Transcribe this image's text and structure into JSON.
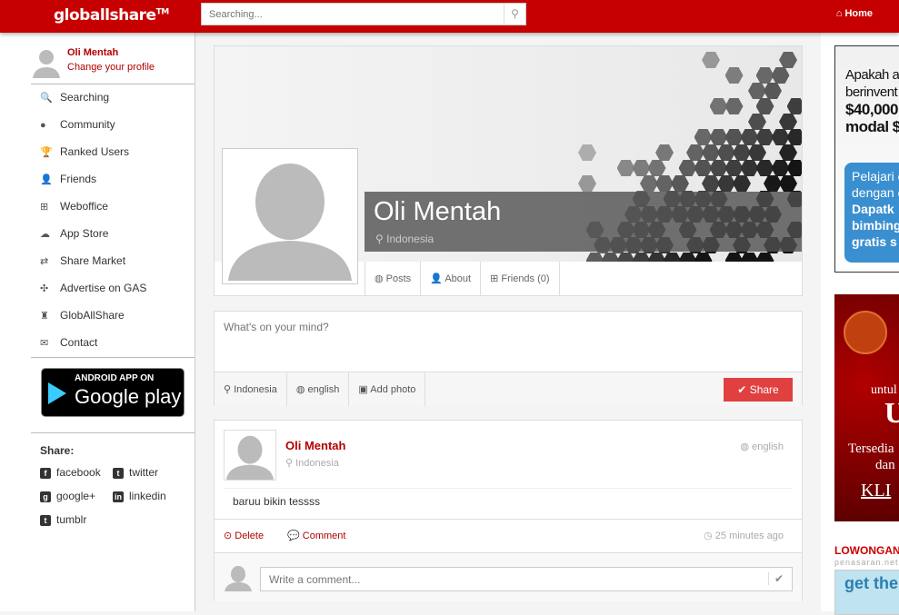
{
  "header": {
    "logo": "globallshare",
    "tm": "TM",
    "search_placeholder": "Searching...",
    "home": "Home"
  },
  "sidebar": {
    "user_name": "Oli Mentah",
    "change_profile": "Change your profile",
    "items": [
      {
        "label": "Searching",
        "icon": "🔍"
      },
      {
        "label": "Community",
        "icon": "●"
      },
      {
        "label": "Ranked Users",
        "icon": "🏆"
      },
      {
        "label": "Friends",
        "icon": "👤"
      },
      {
        "label": "Weboffice",
        "icon": "⊞"
      },
      {
        "label": "App Store",
        "icon": "☁"
      },
      {
        "label": "Share Market",
        "icon": "⇄"
      },
      {
        "label": "Advertise on GAS",
        "icon": "✣"
      },
      {
        "label": "GlobAllShare",
        "icon": "♜"
      },
      {
        "label": "Contact",
        "icon": "✉"
      }
    ],
    "google_play": {
      "line1": "ANDROID APP ON",
      "line2": "Google play"
    },
    "share_title": "Share:",
    "share": [
      {
        "label": "facebook",
        "icon": "f"
      },
      {
        "label": "twitter",
        "icon": "t"
      },
      {
        "label": "google+",
        "icon": "g"
      },
      {
        "label": "linkedin",
        "icon": "in"
      },
      {
        "label": "tumblr",
        "icon": "t"
      }
    ]
  },
  "profile": {
    "name": "Oli Mentah",
    "location": "Indonesia",
    "tabs": [
      "Posts",
      "About",
      "Friends (0)"
    ]
  },
  "composer": {
    "placeholder": "What's on your mind?",
    "location": "Indonesia",
    "language": "english",
    "add_photo": "Add photo",
    "share": "Share"
  },
  "post": {
    "author": "Oli Mentah",
    "location": "Indonesia",
    "language": "english",
    "text": "baruu bikin tessss",
    "delete": "Delete",
    "comment": "Comment",
    "time": "25 minutes ago",
    "comment_placeholder": "Write a comment..."
  },
  "ads": {
    "ad1": [
      "Apakah a",
      "berinvent",
      "$40,000",
      "modal $"
    ],
    "ad1_box": [
      "Pelajari c",
      "dengan c",
      "Dapatk",
      "bimbing",
      "gratis s"
    ],
    "ad2": [
      "untul",
      "U",
      "Tersedia",
      "dan",
      "KLI"
    ],
    "jobs_title": "LOWONGAN",
    "jobs_source": "penasaran.net",
    "ad3": "get the"
  }
}
